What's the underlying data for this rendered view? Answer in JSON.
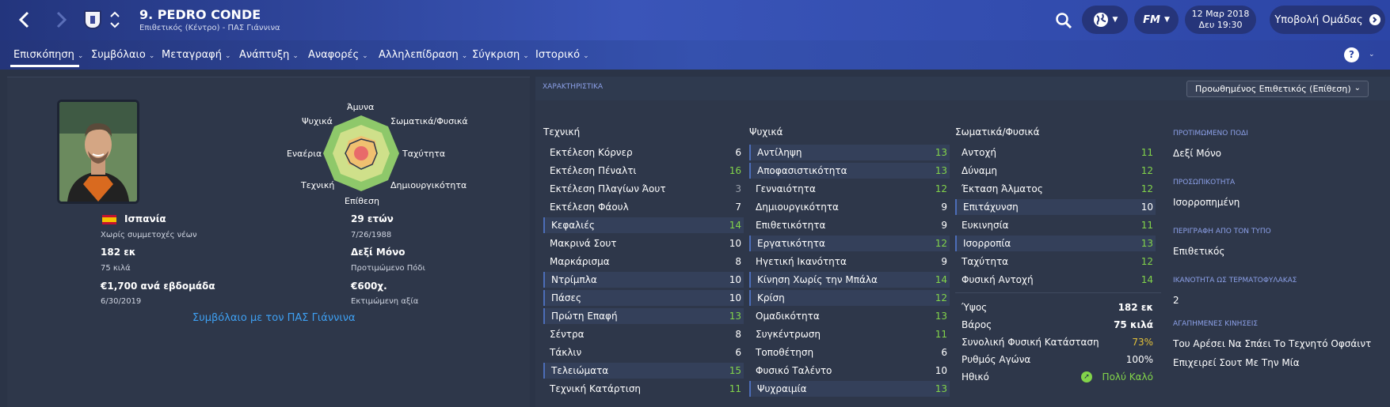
{
  "header": {
    "player_title": "9. PEDRO CONDE",
    "player_subtitle": "Επιθετικός (Κέντρο) - ΠΑΣ Γιάννινα",
    "date": "12 Μαρ 2018",
    "time": "Δευ 19:30",
    "submit_team": "Υποβολή Ομάδας",
    "fm_label": "FM"
  },
  "menu": {
    "items": [
      "Επισκόπηση",
      "Συμβόλαιο",
      "Μεταγραφή",
      "Ανάπτυξη",
      "Αναφορές",
      "Αλληλεπίδραση",
      "Σύγκριση",
      "Ιστορικό"
    ]
  },
  "radar": {
    "labels": {
      "top": "Άμυνα",
      "top_left": "Ψυχικά",
      "top_right": "Σωματικά/Φυσικά",
      "left": "Εναέρια",
      "right": "Ταχύτητα",
      "bottom_left": "Τεχνική",
      "bottom_right": "Δημιουργικότητα",
      "bottom": "Επίθεση"
    },
    "colors": {
      "outer": "#8ec86a",
      "mid": "#cfe08a",
      "inner": "#f0c070",
      "core": "#e86a6a"
    }
  },
  "profile": {
    "nationality": "Ισπανία",
    "youth": "Χωρίς συμμετοχές νέων",
    "age": "29 ετών",
    "dob": "7/26/1988",
    "height": "182 εκ",
    "weight": "75 κιλά",
    "foot": "Δεξί Μόνο",
    "foot_label": "Προτιμώμενο Πόδι",
    "wage": "€1,700 ανά εβδομάδα",
    "contract_end": "6/30/2019",
    "value": "€600χ.",
    "value_label": "Εκτιμώμενη αξία",
    "contract_link": "Συμβόλαιο με τον ΠΑΣ Γιάννινα"
  },
  "attributes": {
    "header_label": "ΧΑΡΑΚΤΗΡΙΣΤΙΚΑ",
    "role": "Προωθημένος Επιθετικός (Επίθεση)",
    "technical_title": "Τεχνική",
    "mental_title": "Ψυχικά",
    "physical_title": "Σωματικά/Φυσικά",
    "technical": [
      {
        "name": "Εκτέλεση Κόρνερ",
        "value": "6"
      },
      {
        "name": "Εκτέλεση Πέναλτι",
        "value": "16"
      },
      {
        "name": "Εκτέλεση Πλαγίων Άουτ",
        "value": "3"
      },
      {
        "name": "Εκτέλεση Φάουλ",
        "value": "7"
      },
      {
        "name": "Κεφαλιές",
        "value": "14"
      },
      {
        "name": "Μακρινά Σουτ",
        "value": "10"
      },
      {
        "name": "Μαρκάρισμα",
        "value": "8"
      },
      {
        "name": "Ντρίμπλα",
        "value": "10"
      },
      {
        "name": "Πάσες",
        "value": "10"
      },
      {
        "name": "Πρώτη Επαφή",
        "value": "13"
      },
      {
        "name": "Σέντρα",
        "value": "8"
      },
      {
        "name": "Τάκλιν",
        "value": "6"
      },
      {
        "name": "Τελειώματα",
        "value": "15"
      },
      {
        "name": "Τεχνική Κατάρτιση",
        "value": "11"
      }
    ],
    "mental": [
      {
        "name": "Αντίληψη",
        "value": "13"
      },
      {
        "name": "Αποφασιστικότητα",
        "value": "13"
      },
      {
        "name": "Γενναιότητα",
        "value": "12"
      },
      {
        "name": "Δημιουργικότητα",
        "value": "9"
      },
      {
        "name": "Επιθετικότητα",
        "value": "9"
      },
      {
        "name": "Εργατικότητα",
        "value": "12"
      },
      {
        "name": "Ηγετική Ικανότητα",
        "value": "9"
      },
      {
        "name": "Κίνηση Χωρίς την Μπάλα",
        "value": "14"
      },
      {
        "name": "Κρίση",
        "value": "12"
      },
      {
        "name": "Ομαδικότητα",
        "value": "13"
      },
      {
        "name": "Συγκέντρωση",
        "value": "11"
      },
      {
        "name": "Τοποθέτηση",
        "value": "6"
      },
      {
        "name": "Φυσικό Ταλέντο",
        "value": "10"
      },
      {
        "name": "Ψυχραιμία",
        "value": "13"
      }
    ],
    "physical": [
      {
        "name": "Αντοχή",
        "value": "11"
      },
      {
        "name": "Δύναμη",
        "value": "12"
      },
      {
        "name": "Έκταση Άλματος",
        "value": "12"
      },
      {
        "name": "Επιτάχυνση",
        "value": "10"
      },
      {
        "name": "Ευκινησία",
        "value": "11"
      },
      {
        "name": "Ισορροπία",
        "value": "13"
      },
      {
        "name": "Ταχύτητα",
        "value": "12"
      },
      {
        "name": "Φυσική Αντοχή",
        "value": "14"
      }
    ],
    "extra": [
      {
        "name": "Ύψος",
        "value": "182 εκ"
      },
      {
        "name": "Βάρος",
        "value": "75 κιλά"
      },
      {
        "name": "Συνολική Φυσική Κατάσταση",
        "value": "73%"
      },
      {
        "name": "Ρυθμός Αγώνα",
        "value": "100%"
      },
      {
        "name": "Ηθικό",
        "value": "Πολύ Καλό"
      }
    ]
  },
  "side": [
    {
      "h": "ΠΡΟΤΙΜΩΜΕΝΟ ΠΟΔΙ",
      "v": [
        "Δεξί Μόνο"
      ]
    },
    {
      "h": "ΠΡΟΣΩΠΙΚΟΤΗΤΑ",
      "v": [
        "Ισορροπημένη"
      ]
    },
    {
      "h": "ΠΕΡΙΓΡΑΦΗ ΑΠΟ ΤΟΝ ΤΥΠΟ",
      "v": [
        "Επιθετικός"
      ]
    },
    {
      "h": "ΙΚΑΝΟΤΗΤΑ ΩΣ ΤΕΡΜΑΤΟΦΥΛΑΚΑΣ",
      "v": [
        "2"
      ]
    },
    {
      "h": "ΑΓΑΠΗΜΕΝΕΣ ΚΙΝΗΣΕΙΣ",
      "v": [
        "Του Αρέσει Να Σπάει Το Τεχνητό Οφσάιντ",
        "Επιχειρεί Σουτ Με Την Μία"
      ]
    }
  ]
}
